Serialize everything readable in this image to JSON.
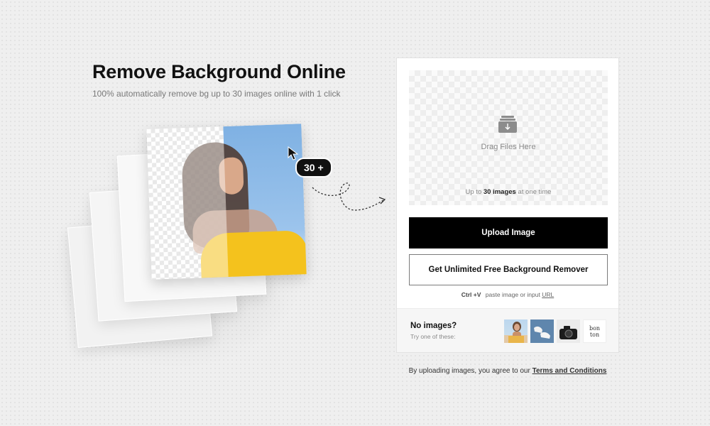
{
  "hero": {
    "title": "Remove Background Online",
    "subtitle": "100% automatically remove bg up to 30 images online with 1 click",
    "badge": "30 +"
  },
  "upload_panel": {
    "drop_label": "Drag Files Here",
    "limit_prefix": "Up to",
    "limit_strong": "30 images",
    "limit_suffix": "at one time",
    "upload_button": "Upload Image",
    "unlimited_button": "Get Unlimited Free Background Remover",
    "paste_kbd": "Ctrl +V",
    "paste_text": "paste image or input",
    "paste_link": "URL"
  },
  "samples": {
    "title": "No images?",
    "subtitle": "Try one of these:",
    "logo_line1": "bon",
    "logo_line2": "ton"
  },
  "footer": {
    "terms_text": "By uploading images, you agree to our",
    "terms_link": "Terms and Conditions"
  },
  "colors": {
    "primary_button": "#000000",
    "accent_yellow": "#f4c21d",
    "background": "#efefef"
  },
  "icons": [
    "cursor-icon",
    "curly-arrow-icon",
    "download-tray-icon"
  ]
}
